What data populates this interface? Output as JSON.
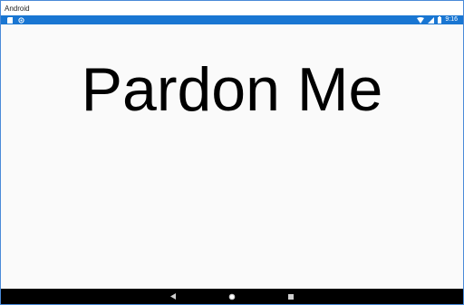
{
  "window": {
    "title": "Android"
  },
  "status_bar": {
    "left_icons": [
      "sd-card-icon",
      "sync-icon"
    ],
    "right_icons": [
      "wifi-icon",
      "signal-icon",
      "battery-icon"
    ],
    "time": "9:16",
    "color": "#1976d2"
  },
  "main": {
    "message": "Pardon Me"
  },
  "nav_bar": {
    "buttons": [
      "back-icon",
      "home-icon",
      "recents-icon"
    ]
  }
}
